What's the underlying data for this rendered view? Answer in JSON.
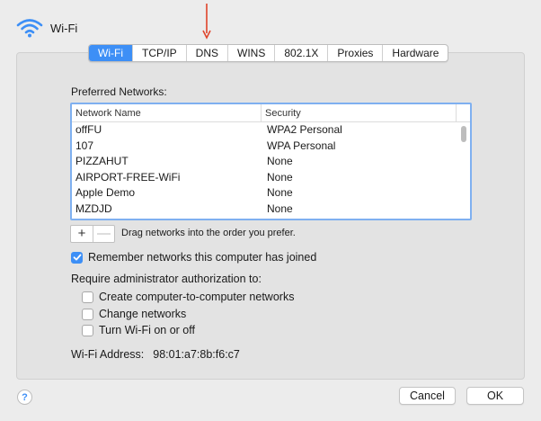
{
  "header": {
    "title": "Wi-Fi",
    "icon": "wifi-icon"
  },
  "tabs": [
    "Wi-Fi",
    "TCP/IP",
    "DNS",
    "WINS",
    "802.1X",
    "Proxies",
    "Hardware"
  ],
  "preferred_networks": {
    "label": "Preferred Networks:",
    "columns": {
      "name": "Network Name",
      "security": "Security"
    },
    "rows": [
      {
        "name": "offFU",
        "security": "WPA2 Personal"
      },
      {
        "name": "107",
        "security": "WPA Personal"
      },
      {
        "name": "PIZZAHUT",
        "security": "None"
      },
      {
        "name": "AIRPORT-FREE-WiFi",
        "security": "None"
      },
      {
        "name": "Apple Demo",
        "security": "None"
      },
      {
        "name": "MZDJD",
        "security": "None"
      }
    ]
  },
  "list_controls": {
    "add": "+",
    "remove": "—",
    "hint": "Drag networks into the order you prefer."
  },
  "remember": {
    "label": "Remember networks this computer has joined",
    "checked": true
  },
  "admin": {
    "label": "Require administrator authorization to:",
    "options": [
      {
        "label": "Create computer-to-computer networks",
        "checked": false
      },
      {
        "label": "Change networks",
        "checked": false
      },
      {
        "label": "Turn Wi-Fi on or off",
        "checked": false
      }
    ]
  },
  "wifi_address": {
    "label": "Wi-Fi Address:",
    "value": "98:01:a7:8b:f6:c7"
  },
  "footer": {
    "help": "?",
    "cancel": "Cancel",
    "ok": "OK"
  },
  "colors": {
    "accent": "#3d8ff6",
    "annotation_arrow": "#e0442b"
  }
}
